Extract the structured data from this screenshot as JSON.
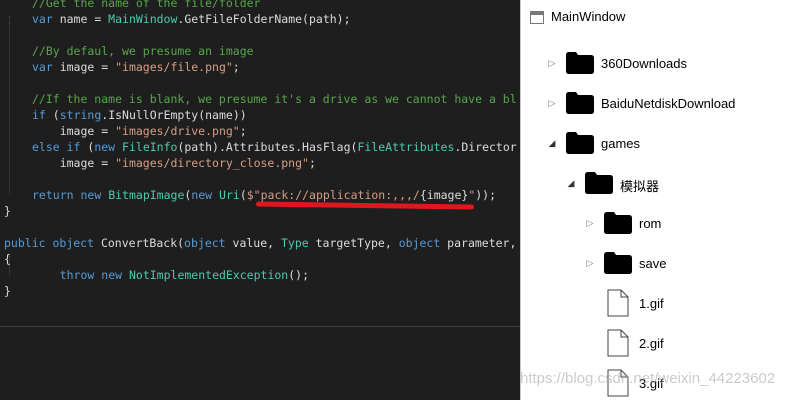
{
  "code": {
    "lines": [
      {
        "t": [
          [
            "cm",
            "//Get the name of the file/folder"
          ]
        ]
      },
      {
        "t": [
          [
            "kw",
            "var"
          ],
          [
            "pl",
            " name = "
          ],
          [
            "ty",
            "MainWindow"
          ],
          [
            "pl",
            ".GetFileFolderName(path);"
          ]
        ]
      },
      {
        "t": []
      },
      {
        "t": [
          [
            "cm",
            "//By defaul, we presume an image"
          ]
        ]
      },
      {
        "t": [
          [
            "kw",
            "var"
          ],
          [
            "pl",
            " image = "
          ],
          [
            "str",
            "\"images/file.png\""
          ],
          [
            "pl",
            ";"
          ]
        ]
      },
      {
        "t": []
      },
      {
        "t": [
          [
            "cm",
            "//If the name is blank, we presume it's a drive as we cannot have a bl"
          ]
        ]
      },
      {
        "t": [
          [
            "kw",
            "if"
          ],
          [
            "pl",
            " ("
          ],
          [
            "kw",
            "string"
          ],
          [
            "pl",
            ".IsNullOrEmpty(name))"
          ]
        ]
      },
      {
        "t": [
          [
            "pl",
            "    image = "
          ],
          [
            "str",
            "\"images/drive.png\""
          ],
          [
            "pl",
            ";"
          ]
        ]
      },
      {
        "t": [
          [
            "kw",
            "else if"
          ],
          [
            "pl",
            " ("
          ],
          [
            "kw",
            "new"
          ],
          [
            "pl",
            " "
          ],
          [
            "ty",
            "FileInfo"
          ],
          [
            "pl",
            "(path).Attributes.HasFlag("
          ],
          [
            "ty",
            "FileAttributes"
          ],
          [
            "pl",
            ".Director"
          ]
        ]
      },
      {
        "t": [
          [
            "pl",
            "    image = "
          ],
          [
            "str",
            "\"images/directory_close.png\""
          ],
          [
            "pl",
            ";"
          ]
        ]
      },
      {
        "t": []
      },
      {
        "t": [
          [
            "kw",
            "return"
          ],
          [
            "pl",
            " "
          ],
          [
            "kw",
            "new"
          ],
          [
            "pl",
            " "
          ],
          [
            "ty",
            "BitmapImage"
          ],
          [
            "pl",
            "("
          ],
          [
            "kw",
            "new"
          ],
          [
            "pl",
            " "
          ],
          [
            "ty",
            "Uri"
          ],
          [
            "pl",
            "("
          ],
          [
            "str",
            "$\"pack://application:,,,/"
          ],
          [
            "pl",
            "{image}"
          ],
          [
            "str",
            "\""
          ],
          [
            "pl",
            "));"
          ]
        ]
      },
      {
        "t": [
          [
            "pl",
            "}"
          ]
        ]
      },
      {
        "t": []
      },
      {
        "t": [
          [
            "kw",
            "public"
          ],
          [
            "pl",
            " "
          ],
          [
            "kw",
            "object"
          ],
          [
            "pl",
            " ConvertBack("
          ],
          [
            "kw",
            "object"
          ],
          [
            "pl",
            " value, "
          ],
          [
            "ty",
            "Type"
          ],
          [
            "pl",
            " targetType, "
          ],
          [
            "kw",
            "object"
          ],
          [
            "pl",
            " parameter,"
          ]
        ]
      },
      {
        "t": [
          [
            "pl",
            "{"
          ]
        ]
      },
      {
        "t": [
          [
            "pl",
            "    "
          ],
          [
            "kw",
            "throw"
          ],
          [
            "pl",
            " "
          ],
          [
            "kw",
            "new"
          ],
          [
            "pl",
            " "
          ],
          [
            "ty",
            "NotImplementedException"
          ],
          [
            "pl",
            "();"
          ]
        ]
      },
      {
        "t": [
          [
            "pl",
            "}"
          ]
        ]
      }
    ]
  },
  "window": {
    "title": "MainWindow"
  },
  "tree": [
    {
      "label": "360Downloads",
      "kind": "folder",
      "state": "collapsed"
    },
    {
      "label": "BaiduNetdiskDownload",
      "kind": "folder",
      "state": "collapsed"
    },
    {
      "label": "games",
      "kind": "folder",
      "state": "expanded"
    },
    {
      "label": "模拟器",
      "kind": "folder",
      "state": "expanded"
    },
    {
      "label": "rom",
      "kind": "folder",
      "state": "collapsed"
    },
    {
      "label": "save",
      "kind": "folder",
      "state": "collapsed"
    },
    {
      "label": "1.gif",
      "kind": "file",
      "state": "leaf"
    },
    {
      "label": "2.gif",
      "kind": "file",
      "state": "leaf"
    },
    {
      "label": "3.gif",
      "kind": "file",
      "state": "leaf"
    }
  ],
  "watermark": "https://blog.csdn.net/weixin_44223602",
  "colors": {
    "editor_bg": "#1e1e1e",
    "keyword": "#569cd6",
    "type": "#4ec9b0",
    "string": "#d69d85",
    "comment": "#57a64a",
    "highlight_underline": "#e0171f"
  }
}
